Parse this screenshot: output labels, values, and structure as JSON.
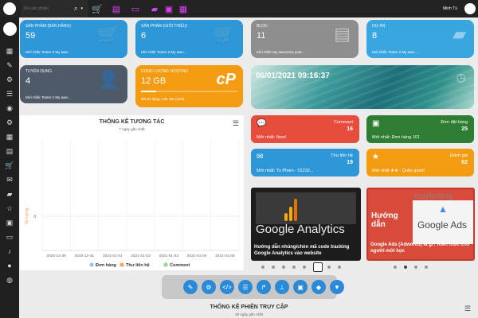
{
  "topbar": {
    "search_placeholder": "Tên sản phẩm",
    "user_name": "Minh Tú"
  },
  "cards": [
    {
      "title": "Sản phẩm (bán hàng)",
      "value": "59",
      "sub": "Mới nhất: Tester 2 My awe...",
      "color": "#2d97d8"
    },
    {
      "title": "Sản phẩm (giới thiệu)",
      "value": "6",
      "sub": "Mới nhất: Tester 2 My awe...",
      "color": "#2d97d8"
    },
    {
      "title": "Blog",
      "value": "11",
      "sub": "Mới nhất: My awesome post...",
      "color": "#8e8e8e"
    },
    {
      "title": "Dự án",
      "value": "8",
      "sub": "Mới nhất: Tester 2 My awe...",
      "color": "#3aa6e0"
    },
    {
      "title": "Tuyển dụng",
      "value": "4",
      "sub": "Mới nhất: Tester 2 My awe...",
      "color": "#4f5a68"
    },
    {
      "title": "Dung lượng hosting",
      "value": "12 GB",
      "sub": "Đã sử dụng 1.85 GB (16%)",
      "color": "#f39c12"
    }
  ],
  "datetime": "06/01/2021 09:16:37",
  "smallcards": [
    {
      "title": "Comment",
      "value": "16",
      "sub": "Mới nhất: Now!",
      "color": "#e74c3c"
    },
    {
      "title": "Đơn đặt hàng",
      "value": "25",
      "sub": "Mới nhất: Đơn hàng 101",
      "color": "#2e7d32"
    },
    {
      "title": "Thư liên hệ",
      "value": "19",
      "sub": "Mới nhất: Tu Pham - 01232...",
      "color": "#2d97d8"
    },
    {
      "title": "Đánh giá",
      "value": "62",
      "sub": "Mới nhất ★★ : Quite good!",
      "color": "#f39c12"
    }
  ],
  "chart_data": {
    "type": "line",
    "title": "THỐNG KÊ TƯƠNG TÁC",
    "subtitle": "7 ngày gần nhất",
    "ylabel": "Số lượng",
    "categories": [
      "2020-12-30",
      "2020-12-31",
      "2021-01-01",
      "2021-01-02",
      "2021-01-03",
      "2021-01-04",
      "2021-01-05"
    ],
    "yticks": [
      "0"
    ],
    "series": [
      {
        "name": "Đơn hàng",
        "color": "#90c4ec",
        "values": [
          0,
          0,
          0,
          0,
          0,
          0,
          0
        ]
      },
      {
        "name": "Thư liên hệ",
        "color": "#f0a860",
        "values": [
          0,
          0,
          0,
          0,
          0,
          0,
          0
        ]
      },
      {
        "name": "Comment",
        "color": "#8ed88e",
        "values": [
          0,
          0,
          0,
          0,
          0,
          0,
          0
        ]
      }
    ],
    "credit": "Highcharts.com"
  },
  "slides": [
    {
      "caption": "Hướng dẫn nhúng/chèn mã code tracking Google Analytics vào website",
      "banner": "Google Analytics"
    },
    {
      "caption": "Google Ads (Adwords) là gì? Kiến thức cho người mới học",
      "banner_left": "Hướng dẫn",
      "banner_right": "Google Ads",
      "banner_top": "marketing"
    }
  ],
  "session": {
    "title": "THỐNG KÊ PHIÊN TRUY CẬP",
    "subtitle": "30 ngày gần nhất"
  }
}
